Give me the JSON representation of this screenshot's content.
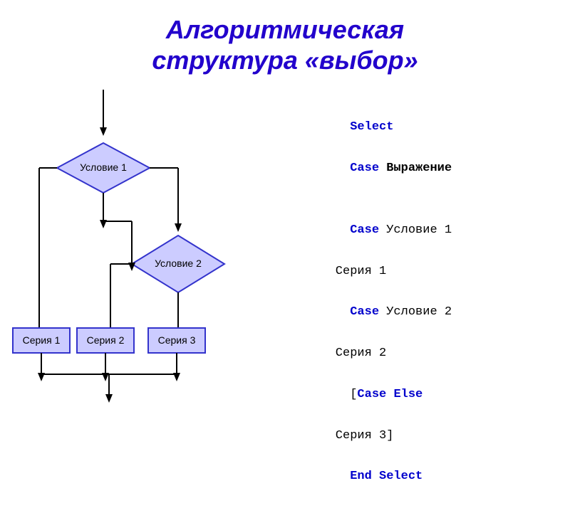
{
  "title_line1": "Алгоритмическая",
  "title_line2": "структура «выбор»",
  "flowchart": {
    "diamond1_label": "Условие 1",
    "diamond2_label": "Условие 2",
    "box1_label": "Серия 1",
    "box2_label": "Серия 2",
    "box3_label": "Серия 3"
  },
  "code": {
    "line1_kw1": "Select",
    "line1_kw2": "Case",
    "line1_rest": " Выражение",
    "line2_kw": "Case",
    "line2_rest": " Условие 1",
    "line3": "    Серия 1",
    "line4_kw": "Case",
    "line4_rest": " Условие 2",
    "line5": "    Серия 2",
    "line6_bracket": "[",
    "line6_kw1": "Case",
    "line6_kw2": "Else",
    "line7": "    Серия 3]",
    "line8_kw1": "End",
    "line8_kw2": "Select"
  }
}
